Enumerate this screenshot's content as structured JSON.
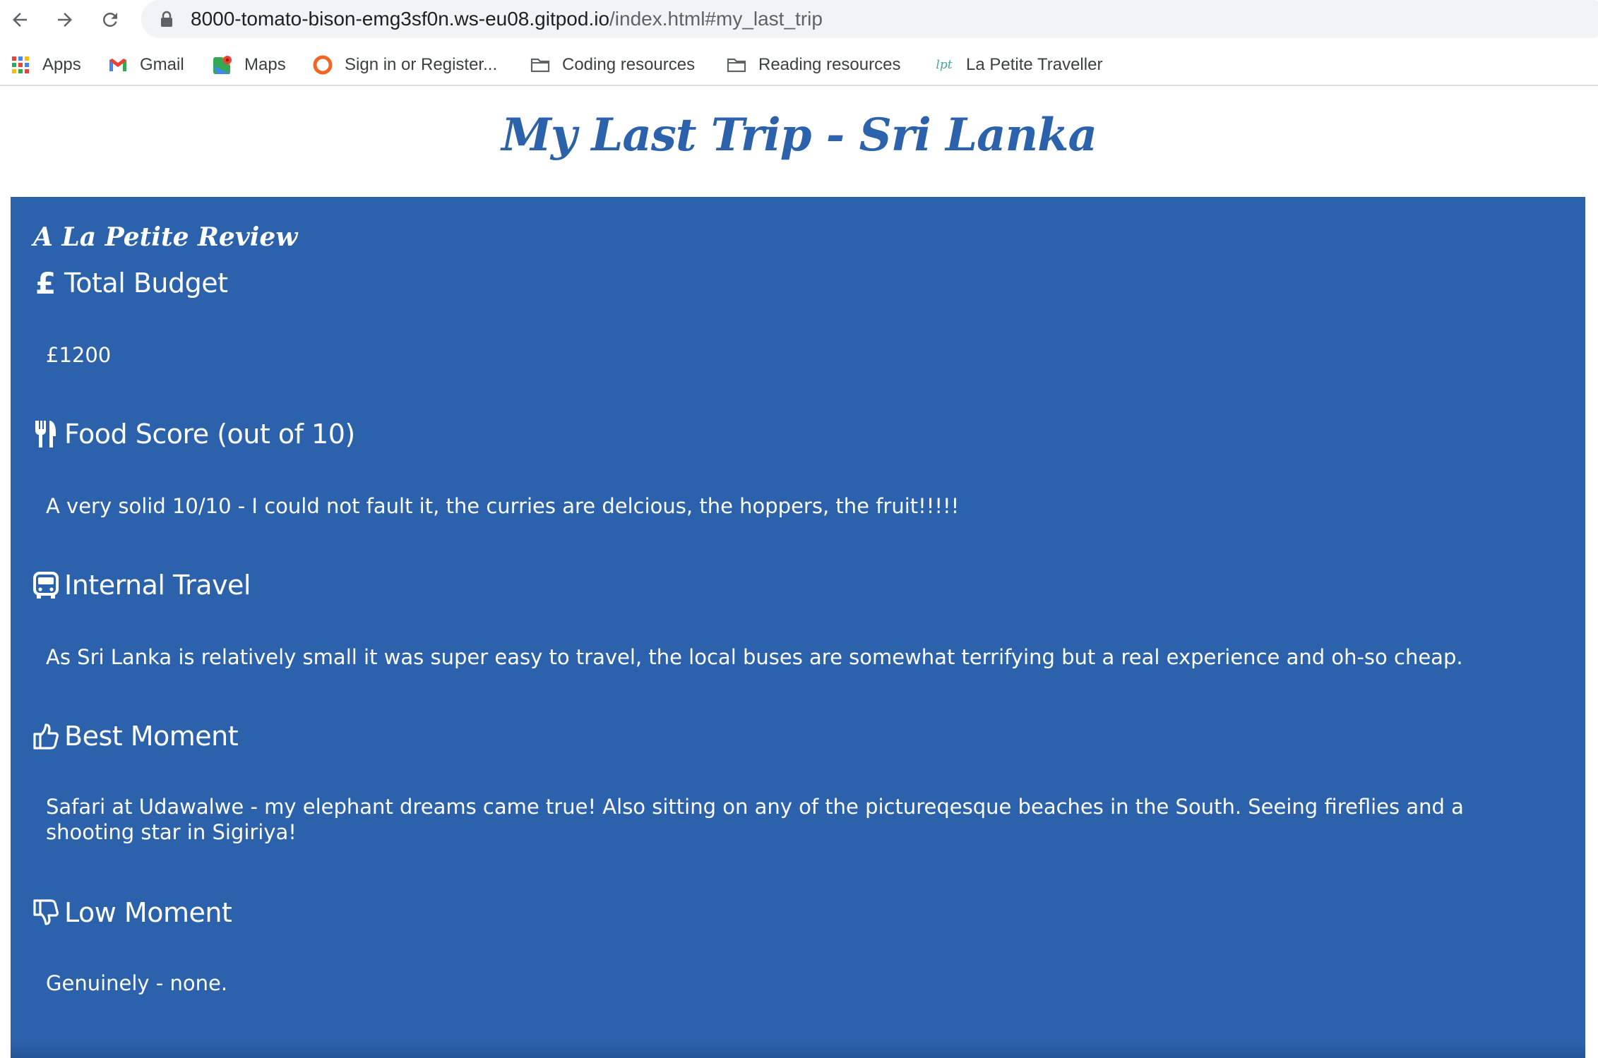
{
  "browser": {
    "url_host": "8000-tomato-bison-emg3sf0n.ws-eu08.gitpod.io",
    "url_path": "/index.html#my_last_trip"
  },
  "bookmarks": [
    {
      "label": "Apps",
      "icon": "apps-grid-icon"
    },
    {
      "label": "Gmail",
      "icon": "gmail-icon"
    },
    {
      "label": "Maps",
      "icon": "maps-icon"
    },
    {
      "label": "Sign in or Register...",
      "icon": "ring-icon"
    },
    {
      "label": "Coding resources",
      "icon": "folder-icon"
    },
    {
      "label": "Reading resources",
      "icon": "folder-icon"
    },
    {
      "label": "La Petite Traveller",
      "icon": "lpt-icon"
    }
  ],
  "lpt_icon_text": "lpt",
  "page": {
    "title": "My Last Trip - Sri Lanka",
    "review_heading": "A La Petite Review",
    "sections": [
      {
        "icon": "pound-icon",
        "heading": "Total Budget",
        "text": "£1200"
      },
      {
        "icon": "cutlery-icon",
        "heading": "Food Score (out of 10)",
        "text": "A very solid 10/10 - I could not fault it, the curries are delcious, the hoppers, the fruit!!!!!"
      },
      {
        "icon": "bus-icon",
        "heading": "Internal Travel",
        "text": "As Sri Lanka is relatively small it was super easy to travel, the local buses are somewhat terrifying but a real experience and oh-so cheap."
      },
      {
        "icon": "thumbs-up-icon",
        "heading": "Best Moment",
        "text": "Safari at Udawalwe - my elephant dreams came true! Also sitting on any of the pictureqesque beaches in the South. Seeing fireflies and a shooting star in Sigiriya!"
      },
      {
        "icon": "thumbs-down-icon",
        "heading": "Low Moment",
        "text": "Genuinely - none."
      }
    ]
  },
  "colors": {
    "brand_blue": "#2b62ab",
    "panel_text": "#ffffff"
  }
}
